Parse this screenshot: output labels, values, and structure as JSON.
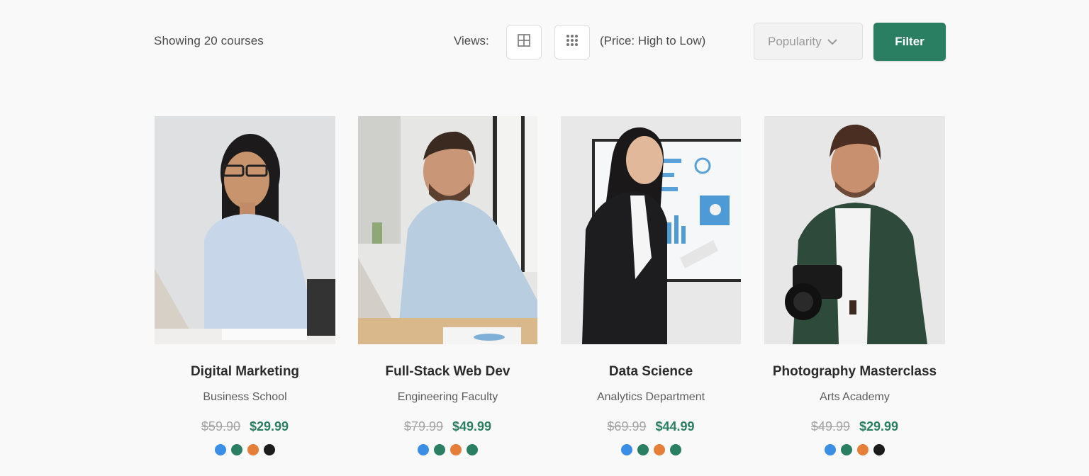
{
  "toolbar": {
    "showing_text": "Showing 20 courses",
    "views_label": "Views:",
    "view_options": [
      {
        "icon": "grid-2x2-icon"
      },
      {
        "icon": "grid-3x3-icon"
      }
    ],
    "sort_text": "(Price: High to Low)",
    "sort_select_value": "Popularity",
    "filter_label": "Filter",
    "filter_color": "#2a7f62"
  },
  "courses": [
    {
      "title": "Digital Marketing",
      "department": "Business School",
      "old_price": "$59.90",
      "new_price": "$29.99",
      "swatches": [
        "#3a8ee6",
        "#2a7f62",
        "#e67e3a",
        "#1c1c1c"
      ]
    },
    {
      "title": "Full-Stack Web Dev",
      "department": "Engineering Faculty",
      "old_price": "$79.99",
      "new_price": "$49.99",
      "swatches": [
        "#3a8ee6",
        "#2a7f62",
        "#e67e3a",
        "#2a7f62"
      ]
    },
    {
      "title": "Data Science",
      "department": "Analytics Department",
      "old_price": "$69.99",
      "new_price": "$44.99",
      "swatches": [
        "#3a8ee6",
        "#2a7f62",
        "#e67e3a",
        "#2a7f62"
      ]
    },
    {
      "title": "Photography Masterclass",
      "department": "Arts Academy",
      "old_price": "$49.99",
      "new_price": "$29.99",
      "swatches": [
        "#3a8ee6",
        "#2a7f62",
        "#e67e3a",
        "#1c1c1c"
      ]
    }
  ]
}
